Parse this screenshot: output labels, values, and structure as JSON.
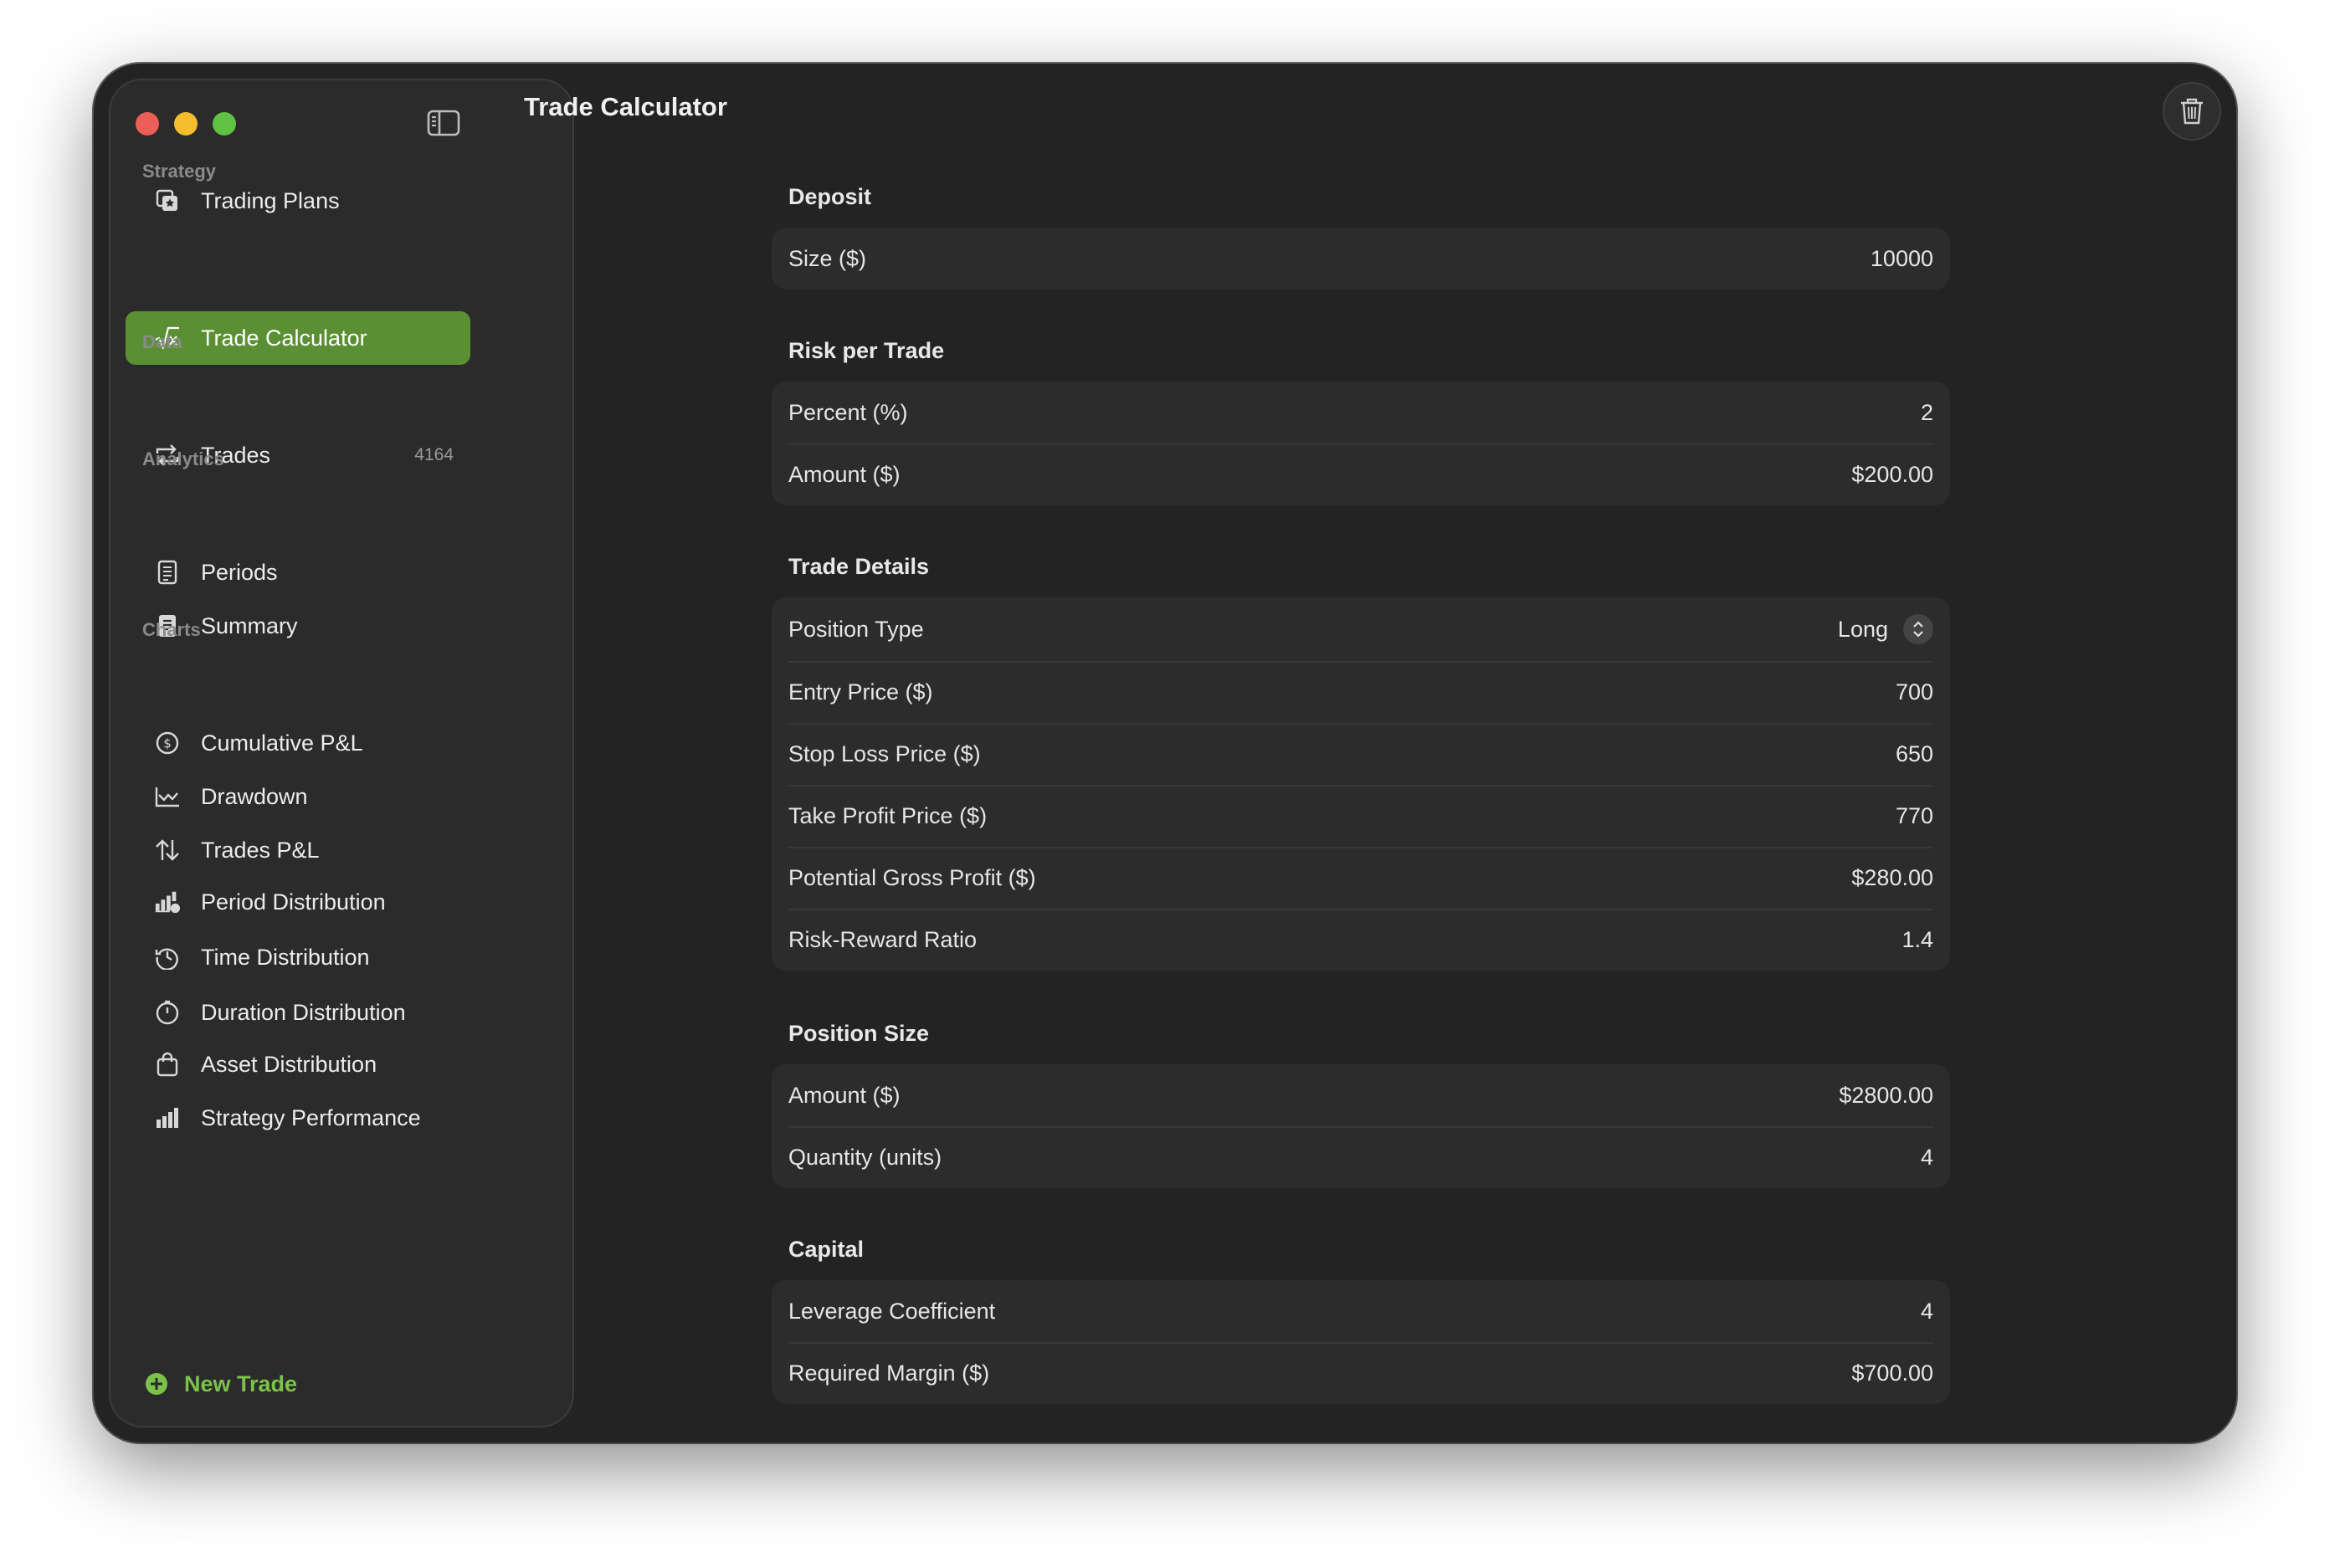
{
  "window": {
    "title": "Trade Calculator"
  },
  "sidebar": {
    "sections": [
      {
        "label": "Strategy",
        "items": [
          {
            "label": "Trading Plans",
            "icon": "trading-plans-icon"
          },
          {
            "label": "Trade Calculator",
            "icon": "square-root-icon",
            "selected": true
          }
        ]
      },
      {
        "label": "Data",
        "items": [
          {
            "label": "Trades",
            "icon": "repeat-arrows-icon",
            "count": "4164"
          }
        ]
      },
      {
        "label": "Analytics",
        "items": [
          {
            "label": "Periods",
            "icon": "calendar-list-icon"
          },
          {
            "label": "Summary",
            "icon": "document-icon"
          }
        ]
      },
      {
        "label": "Charts",
        "items": [
          {
            "label": "Cumulative P&L",
            "icon": "dollar-circle-icon"
          },
          {
            "label": "Drawdown",
            "icon": "line-chart-icon"
          },
          {
            "label": "Trades P&L",
            "icon": "up-down-arrows-icon"
          },
          {
            "label": "Period Distribution",
            "icon": "bar-chart-badge-icon"
          },
          {
            "label": "Time Distribution",
            "icon": "clock-history-icon"
          },
          {
            "label": "Duration Distribution",
            "icon": "timer-icon"
          },
          {
            "label": "Asset Distribution",
            "icon": "shopping-bag-icon"
          },
          {
            "label": "Strategy Performance",
            "icon": "bar-chart-icon"
          }
        ]
      }
    ],
    "new_trade_label": "New Trade"
  },
  "form": {
    "deposit": {
      "title": "Deposit",
      "rows": [
        {
          "label": "Size ($)",
          "value": "10000"
        }
      ]
    },
    "risk": {
      "title": "Risk per Trade",
      "rows": [
        {
          "label": "Percent (%)",
          "value": "2"
        },
        {
          "label": "Amount ($)",
          "value": "$200.00"
        }
      ]
    },
    "trade_details": {
      "title": "Trade Details",
      "position_type": {
        "label": "Position Type",
        "value": "Long"
      },
      "rows": [
        {
          "label": "Entry Price ($)",
          "value": "700"
        },
        {
          "label": "Stop Loss Price ($)",
          "value": "650"
        },
        {
          "label": "Take Profit Price ($)",
          "value": "770"
        },
        {
          "label": "Potential Gross Profit ($)",
          "value": "$280.00"
        },
        {
          "label": "Risk-Reward Ratio",
          "value": "1.4"
        }
      ]
    },
    "position_size": {
      "title": "Position Size",
      "rows": [
        {
          "label": "Amount ($)",
          "value": "$2800.00"
        },
        {
          "label": "Quantity (units)",
          "value": "4"
        }
      ]
    },
    "capital": {
      "title": "Capital",
      "rows": [
        {
          "label": "Leverage Coefficient",
          "value": "4"
        },
        {
          "label": "Required Margin ($)",
          "value": "$700.00"
        }
      ]
    }
  },
  "colors": {
    "accent": "#5b8f34",
    "new_trade": "#7cc24a"
  }
}
